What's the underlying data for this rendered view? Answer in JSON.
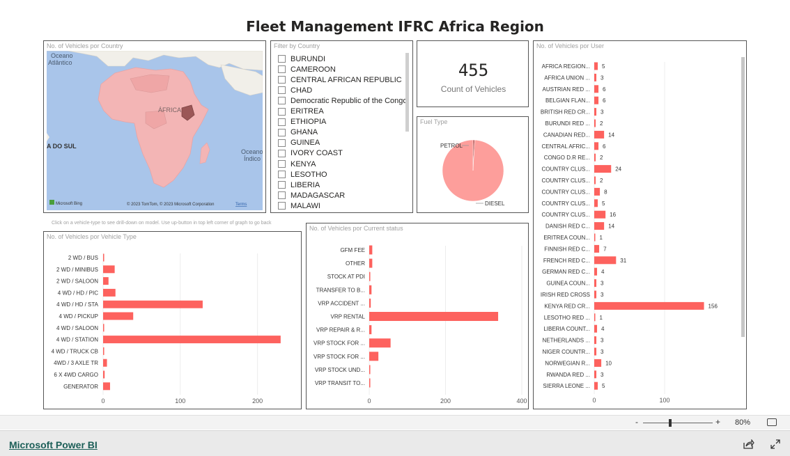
{
  "dashboard": {
    "title": "Fleet Management IFRC Africa Region"
  },
  "map": {
    "title": "No. of Vehicles por Country",
    "labels": {
      "ocean_atlantic_1": "Oceano",
      "ocean_atlantic_2": "Atlântico",
      "africa": "ÁFRICA",
      "south": "A DO SUL",
      "ocean_indian_1": "Oceano",
      "ocean_indian_2": "Índico"
    },
    "bing": "Microsoft Bing",
    "copyright": "© 2023 TomTom, © 2023 Microsoft Corporation",
    "terms": "Terms"
  },
  "filter": {
    "title": "Filter by Country",
    "items": [
      "BURUNDI",
      "CAMEROON",
      "CENTRAL AFRICAN REPUBLIC",
      "CHAD",
      "Democratic Republic of the Congo",
      "ERITREA",
      "ETHIOPIA",
      "GHANA",
      "GUINEA",
      "IVORY COAST",
      "KENYA",
      "LESOTHO",
      "LIBERIA",
      "MADAGASCAR",
      "MALAWI"
    ]
  },
  "count_card": {
    "value": "455",
    "label": "Count of Vehicles"
  },
  "fuel": {
    "title": "Fuel Type",
    "chart_data": {
      "type": "pie",
      "labels": [
        "PETROL",
        "DIESEL"
      ],
      "values": [
        4,
        451
      ]
    }
  },
  "note": "Click on a vehicle-type to see drill-down on model. Use up-button in top left corner of graph to go back",
  "vehicle_type": {
    "title": "No. of Vehicles por Vehicle Type",
    "chart_data": {
      "type": "bar",
      "orientation": "horizontal",
      "categories": [
        "2 WD / BUS",
        "2 WD / MINIBUS",
        "2 WD / SALOON",
        "4 WD / HD / PIC",
        "4 WD / HD / STA",
        "4 WD / PICKUP",
        "4 WD / SALOON",
        "4 WD / STATION",
        "4 WD / TRUCK CB",
        "4WD / 3 AXLE TR",
        "6 X 4WD CARGO",
        "GENERATOR"
      ],
      "values": [
        1,
        15,
        7,
        16,
        129,
        39,
        1,
        230,
        1,
        5,
        2,
        9
      ],
      "xlim": [
        0,
        250
      ],
      "ticks": [
        "0",
        "100",
        "200"
      ],
      "tick_values": [
        0,
        100,
        200
      ]
    }
  },
  "status": {
    "title": "No. of Vehicles por Current status",
    "chart_data": {
      "type": "bar",
      "orientation": "horizontal",
      "categories": [
        "GFM FEE",
        "OTHER",
        "STOCK AT PDI",
        "TRANSFER TO B...",
        "VRP ACCIDENT ...",
        "VRP RENTAL",
        "VRP REPAIR & R...",
        "VRP STOCK FOR ...",
        "VRP STOCK FOR ...",
        "VRP STOCK UND...",
        "VRP TRANSIT TO..."
      ],
      "values": [
        8,
        8,
        2,
        6,
        4,
        338,
        6,
        56,
        24,
        1,
        2
      ],
      "xlim": [
        0,
        400
      ],
      "ticks": [
        "0",
        "200",
        "400"
      ],
      "tick_values": [
        0,
        200,
        400
      ]
    }
  },
  "user": {
    "title": "No. of Vehicles por User",
    "chart_data": {
      "type": "bar",
      "orientation": "horizontal",
      "categories": [
        "AFRICA REGION...",
        "AFRICA UNION ...",
        "AUSTRIAN RED ...",
        "BELGIAN FLAN...",
        "BRITISH RED CR...",
        "BURUNDI RED ...",
        "CANADIAN RED...",
        "CENTRAL AFRIC...",
        "CONGO D.R RE...",
        "COUNTRY CLUS...",
        "COUNTRY CLUS...",
        "COUNTRY CLUS...",
        "COUNTRY CLUS...",
        "COUNTRY CLUS...",
        "DANISH RED C...",
        "ERITREA COUN...",
        "FINNISH RED C...",
        "FRENCH RED C...",
        "GERMAN RED C...",
        "GUINEA COUN...",
        "IRISH RED CROSS",
        "KENYA RED CR...",
        "LESOTHO RED ...",
        "LIBERIA COUNT...",
        "NETHERLANDS ...",
        "NIGER COUNTR...",
        "NORWEGIAN R...",
        "RWANDA RED ...",
        "SIERRA LEONE ..."
      ],
      "values": [
        5,
        3,
        6,
        6,
        3,
        2,
        14,
        6,
        2,
        24,
        2,
        8,
        5,
        16,
        14,
        1,
        7,
        31,
        4,
        3,
        3,
        156,
        1,
        4,
        3,
        3,
        10,
        3,
        5
      ],
      "labels": [
        "5",
        "3",
        "6",
        "6",
        "3",
        "2",
        "14",
        "6",
        "2",
        "24",
        "2",
        "8",
        "5",
        "16",
        "14",
        "1",
        "7",
        "31",
        "4",
        "3",
        "3",
        "156",
        "1",
        "4",
        "3",
        "3",
        "10",
        "3",
        "5"
      ],
      "xlim": [
        0,
        200
      ],
      "ticks": [
        "0",
        "100"
      ],
      "tick_values": [
        0,
        100
      ]
    }
  },
  "zoom": {
    "minus": "-",
    "plus": "+",
    "level": "80%",
    "level_value": 80
  },
  "footer": {
    "link": "Microsoft Power BI"
  },
  "colors": {
    "bar": "#fd625e",
    "pie": "#fd9e9b",
    "pie_dark": "#b54a48",
    "map_water": "#a9c5ea",
    "map_land": "#f1efe9",
    "map_highlight": "#f3b5b5",
    "kenya": "#9b5757"
  }
}
